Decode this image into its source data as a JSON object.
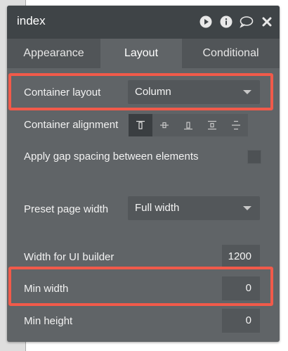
{
  "window": {
    "title": "index"
  },
  "header_icons": [
    "play-icon",
    "info-icon",
    "comment-icon",
    "close-icon"
  ],
  "tabs": [
    {
      "label": "Appearance",
      "active": false
    },
    {
      "label": "Layout",
      "active": true
    },
    {
      "label": "Conditional",
      "active": false
    }
  ],
  "container_layout": {
    "label": "Container layout",
    "value": "Column"
  },
  "container_alignment": {
    "label": "Container alignment",
    "options": [
      "align-top-icon",
      "align-center-icon",
      "align-bottom-icon",
      "space-between-icon",
      "space-around-icon"
    ],
    "selected": 0
  },
  "gap_spacing": {
    "label": "Apply gap spacing between elements",
    "checked": false
  },
  "preset_width": {
    "label": "Preset page width",
    "value": "Full width"
  },
  "ui_builder_width": {
    "label": "Width for UI builder",
    "value": "1200"
  },
  "min_width": {
    "label": "Min width",
    "value": "0"
  },
  "min_height": {
    "label": "Min height",
    "value": "0"
  },
  "colors": {
    "panel": "#606467",
    "header": "#3f4447",
    "highlight": "#f15a4a"
  }
}
